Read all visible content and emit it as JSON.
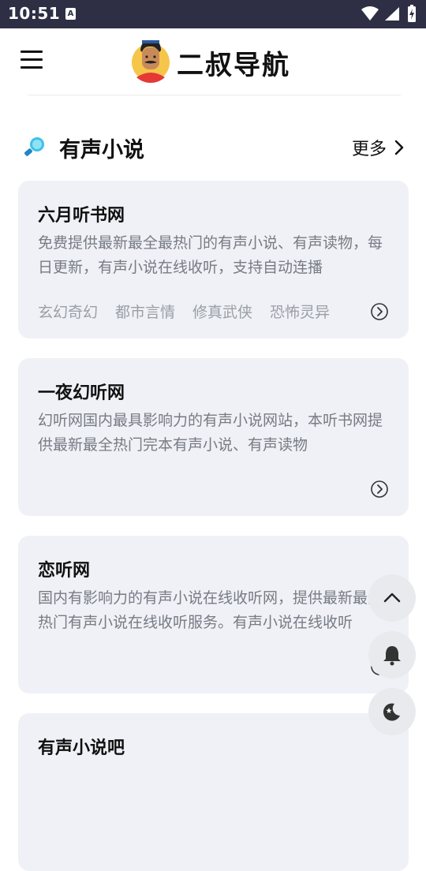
{
  "status_bar": {
    "time": "10:51",
    "notification_glyph": "A"
  },
  "header": {
    "brand": "二叔导航",
    "logo": "avatar-logo",
    "menu_icon": "hamburger-icon"
  },
  "section": {
    "title": "有声小说",
    "more_label": "更多",
    "icon": "magnifier-icon"
  },
  "cards": [
    {
      "title": "六月听书网",
      "description": "免费提供最新最全最热门的有声小说、有声读物，每日更新，有声小说在线收听，支持自动连播",
      "tags": [
        "玄幻奇幻",
        "都市言情",
        "修真武侠",
        "恐怖灵异"
      ]
    },
    {
      "title": "一夜幻听网",
      "description": "幻听网国内最具影响力的有声小说网站，本听书网提供最新最全热门完本有声小说、有声读物",
      "tags": []
    },
    {
      "title": "恋听网",
      "description": "国内有影响力的有声小说在线收听网，提供最新最全热门有声小说在线收听服务。有声小说在线收听",
      "tags": []
    },
    {
      "title": "有声小说吧",
      "description": "",
      "tags": []
    }
  ],
  "fabs": {
    "top": "chevron-up-icon",
    "notify": "bell-icon",
    "theme": "moon-icon"
  },
  "colors": {
    "status_bar": "#2e2f45",
    "card_bg": "#eff1f6",
    "desc_text": "#777b84",
    "tag_text": "#9a9ea6"
  }
}
